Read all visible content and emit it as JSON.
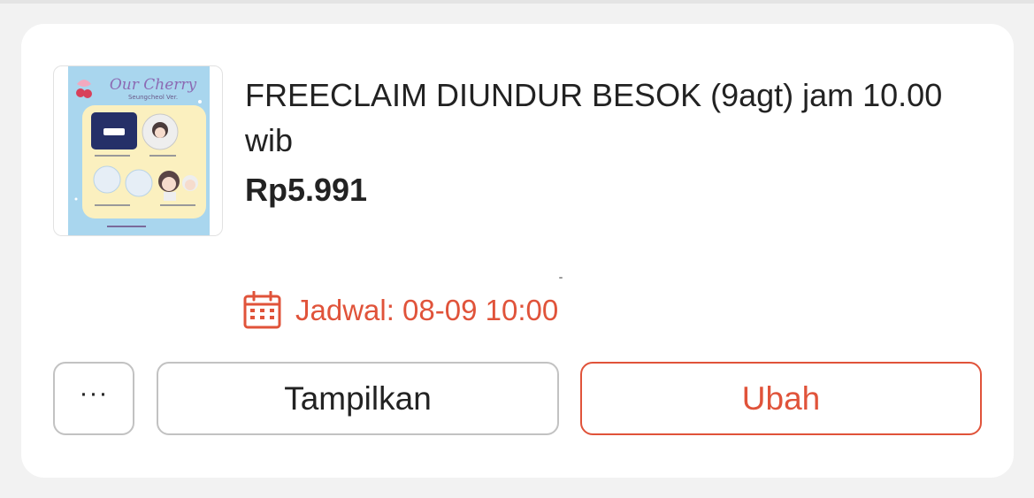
{
  "product": {
    "title": "FREECLAIM DIUNDUR BESOK (9agt) jam 10.00 wib",
    "price": "Rp5.991",
    "thumbnail": {
      "heading": "Our Cherry",
      "subheading": "Seungcheol Ver."
    }
  },
  "schedule": {
    "icon": "calendar-icon",
    "text": "Jadwal: 08-09 10:00"
  },
  "actions": {
    "more_label": "···",
    "show_label": "Tampilkan",
    "edit_label": "Ubah"
  },
  "colors": {
    "accent": "#e0533a",
    "text": "#222222",
    "border": "#c2c2c2",
    "background": "#f2f2f2",
    "card": "#ffffff"
  }
}
